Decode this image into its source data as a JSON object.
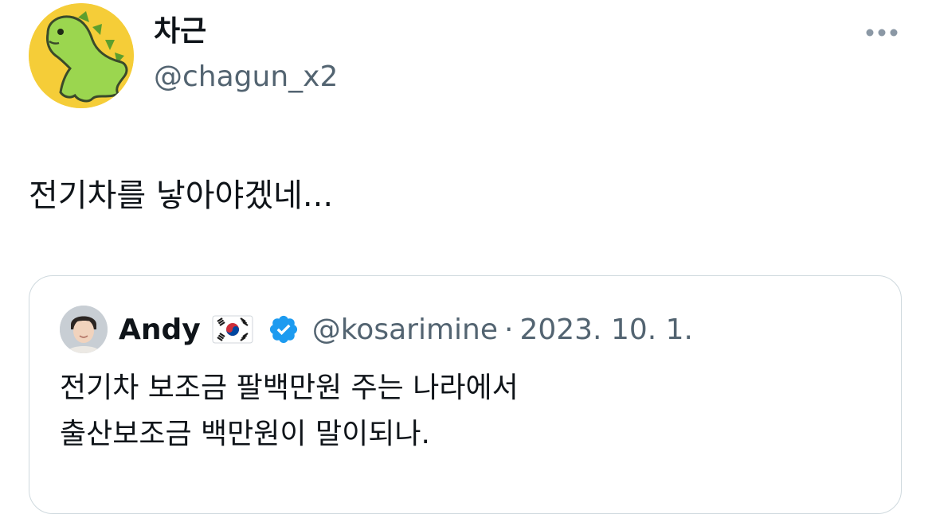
{
  "tweet": {
    "author": {
      "display_name": "차근",
      "handle": "@chagun_x2",
      "avatar_icon": "green-dinosaur-avatar"
    },
    "more_icon": "more-horizontal-icon",
    "text": "전기차를 낳아야겠네..."
  },
  "quote": {
    "author": {
      "display_name": "Andy",
      "flag_icon": "south-korea-flag-icon",
      "verified_icon": "verified-badge-icon",
      "handle": "@kosarimine",
      "separator": "·",
      "date": "2023. 10. 1."
    },
    "lines": [
      "전기차 보조금 팔백만원 주는 나라에서",
      "출산보조금 백만원이 말이되나."
    ]
  },
  "colors": {
    "text_primary": "#0f1419",
    "text_secondary": "#536471",
    "avatar_background": "#f5cd38",
    "dino_green": "#9bd64f",
    "verified_blue": "#1d9bf0",
    "card_border": "#cfd9de"
  }
}
